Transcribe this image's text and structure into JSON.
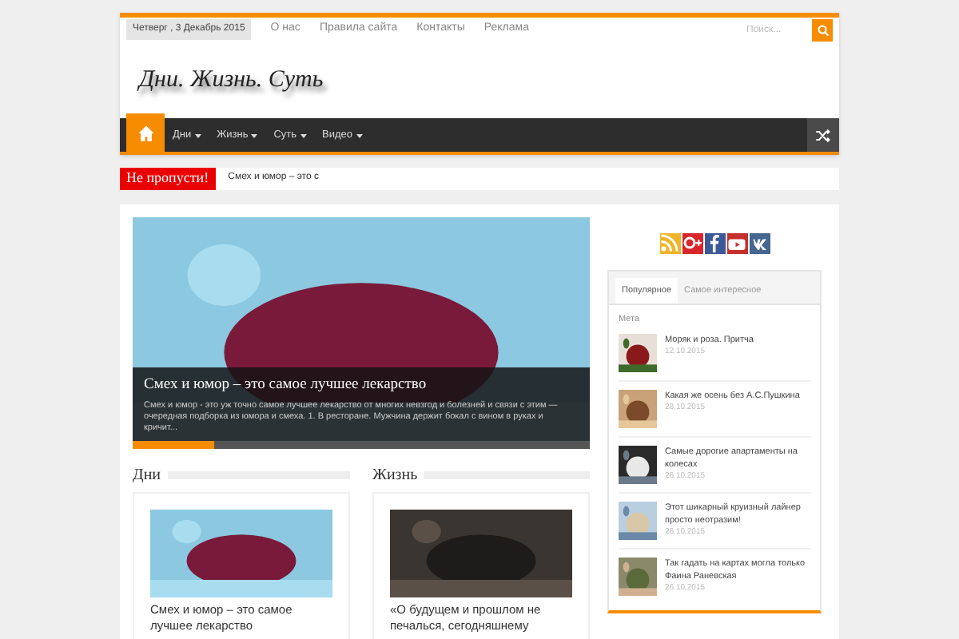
{
  "top_bar": {
    "date": "Четверг , 3 Декабрь 2015",
    "links": [
      "О нас",
      "Правила сайта",
      "Контакты",
      "Реклама"
    ],
    "search": {
      "placeholder": "Поиск..."
    }
  },
  "logo": "Дни. Жизнь. Суть",
  "nav": {
    "items": [
      "Дни",
      "Жизнь",
      "Суть",
      "Видео"
    ]
  },
  "breaking": {
    "label": "Не пропусти!",
    "text": "Смех и юмор – это с"
  },
  "slider": {
    "title": "Смех и юмор – это самое лучшее лекарство",
    "excerpt": "Смех и юмор - это уж точно самое лучшее лекарство от многих невзгод и болезней и связи с этим — очередная подборка из юмора и смеха. 1. В ресторане. Мужчина держит бокал с вином в руках и кричит...",
    "level": 0.18
  },
  "sections": [
    {
      "title": "Дни",
      "post": "Смех и юмор – это самое лучшее лекарство"
    },
    {
      "title": "Жизнь",
      "post": "«О будущем и прошлом не печалься, сегодняшнему"
    }
  ],
  "social": [
    {
      "kind": "rss",
      "color": "#f0b429"
    },
    {
      "kind": "gplus",
      "color": "#d8262b"
    },
    {
      "kind": "facebook",
      "color": "#3b5998"
    },
    {
      "kind": "youtube",
      "color": "#c4302b"
    },
    {
      "kind": "vk",
      "color": "#45668e"
    }
  ],
  "tabs": [
    {
      "label": "Популярное",
      "selected": true
    },
    {
      "label": "Самое интересное",
      "selected": false
    }
  ],
  "tab_sub": "Мета",
  "posts": [
    {
      "title": "Моряк и роза. Притча",
      "date": "12.10.2015"
    },
    {
      "title": "Какая же осень без А.С.Пушкина",
      "date": "28.10.2015"
    },
    {
      "title": "Самые дорогие апартаменты на колесах",
      "date": "26.10.2015"
    },
    {
      "title": "Этот шикарный круизный лайнер просто неотразим!",
      "date": "26.10.2015"
    },
    {
      "title": "Так гадать на картах могла только Фаина Раневская",
      "date": "26.10.2015"
    }
  ]
}
